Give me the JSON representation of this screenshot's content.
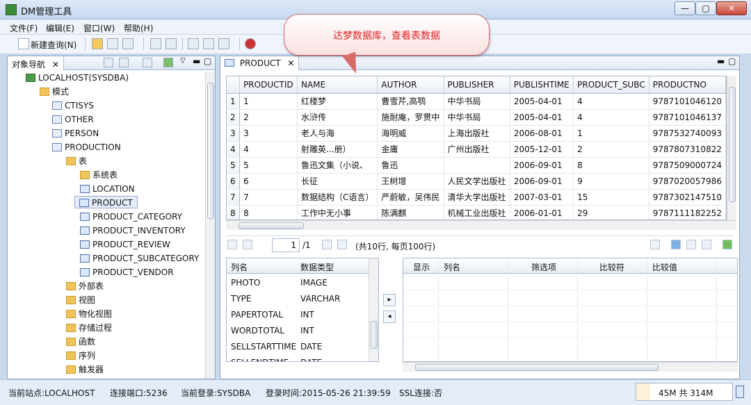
{
  "window": {
    "title": "DM管理工具",
    "controls": [
      "minimize",
      "maximize",
      "close"
    ]
  },
  "menu": [
    "文件(F)",
    "编辑(E)",
    "窗口(W)",
    "帮助(H)"
  ],
  "toolbar": {
    "new_query": "新建查询(N)"
  },
  "callout": "达梦数据库，查看表数据",
  "nav": {
    "tab_label": "对象导航",
    "tree": [
      {
        "label": "LOCALHOST(SYSDBA)",
        "icon": "server-icon"
      },
      {
        "label": "模式",
        "icon": "folder-icon"
      },
      {
        "label": "CTISYS",
        "icon": "schema-icon"
      },
      {
        "label": "OTHER",
        "icon": "schema-icon"
      },
      {
        "label": "PERSON",
        "icon": "schema-icon"
      },
      {
        "label": "PRODUCTION",
        "icon": "schema-icon"
      },
      {
        "label": "表",
        "icon": "folder-icon"
      },
      {
        "label": "系统表",
        "icon": "folder-icon"
      },
      {
        "label": "LOCATION",
        "icon": "table-icon"
      },
      {
        "label": "PRODUCT",
        "icon": "table-icon",
        "selected": true
      },
      {
        "label": "PRODUCT_CATEGORY",
        "icon": "table-icon"
      },
      {
        "label": "PRODUCT_INVENTORY",
        "icon": "table-icon"
      },
      {
        "label": "PRODUCT_REVIEW",
        "icon": "table-icon"
      },
      {
        "label": "PRODUCT_SUBCATEGORY",
        "icon": "table-icon"
      },
      {
        "label": "PRODUCT_VENDOR",
        "icon": "table-icon"
      },
      {
        "label": "外部表",
        "icon": "folder-icon"
      },
      {
        "label": "视图",
        "icon": "folder-icon"
      },
      {
        "label": "物化视图",
        "icon": "folder-icon"
      },
      {
        "label": "存储过程",
        "icon": "folder-icon"
      },
      {
        "label": "函数",
        "icon": "folder-icon"
      },
      {
        "label": "序列",
        "icon": "folder-icon"
      },
      {
        "label": "触发器",
        "icon": "folder-icon"
      }
    ]
  },
  "editor": {
    "tab_label": "PRODUCT",
    "columns": [
      "PRODUCTID",
      "NAME",
      "AUTHOR",
      "PUBLISHER",
      "PUBLISHTIME",
      "PRODUCT_SUBC",
      "PRODUCTNO"
    ],
    "rows": [
      [
        "1",
        "1",
        "红楼梦",
        "曹雪芹,高鹗",
        "中华书局",
        "2005-04-01",
        "4",
        "9787101046120"
      ],
      [
        "2",
        "2",
        "水浒传",
        "施耐庵，罗贯中",
        "中华书局",
        "2005-04-01",
        "4",
        "9787101046137"
      ],
      [
        "3",
        "3",
        "老人与海",
        "海明威",
        "上海出版社",
        "2006-08-01",
        "1",
        "9787532740093"
      ],
      [
        "4",
        "4",
        "射雕英...册）",
        "金庸",
        "广州出版社",
        "2005-12-01",
        "2",
        "9787807310822"
      ],
      [
        "5",
        "5",
        "鲁迅文集（小说、",
        "鲁迅",
        "",
        "2006-09-01",
        "8",
        "9787509000724"
      ],
      [
        "6",
        "6",
        "长征",
        "王树增",
        "人民文学出版社",
        "2006-09-01",
        "9",
        "9787020057986"
      ],
      [
        "7",
        "7",
        "数据结构（C语言）",
        "严蔚敏，吴伟民",
        "清华大学出版社",
        "2007-03-01",
        "15",
        "9787302147510"
      ],
      [
        "8",
        "8",
        "工作中无小事",
        "陈满麒",
        "机械工业出版社",
        "2006-01-01",
        "29",
        "9787111182252"
      ]
    ],
    "pager": {
      "page_input": "1",
      "page_total": "/1",
      "summary": "(共10行, 每页100行)"
    },
    "column_list": {
      "headers": [
        "列名",
        "数据类型"
      ],
      "rows": [
        [
          "PHOTO",
          "IMAGE"
        ],
        [
          "TYPE",
          "VARCHAR"
        ],
        [
          "PAPERTOTAL",
          "INT"
        ],
        [
          "WORDTOTAL",
          "INT"
        ],
        [
          "SELLSTARTTIME",
          "DATE"
        ],
        [
          "SELLENDTIME",
          "DATE"
        ]
      ]
    },
    "filter_headers": [
      "显示",
      "列名",
      "筛选项",
      "比较符",
      "比较值"
    ]
  },
  "status": {
    "site": "当前站点:LOCALHOST",
    "port": "连接端口:5236",
    "login": "当前登录:SYSDBA",
    "login_time": "登录时间:2015-05-26 21:39:59",
    "ssl": "SSL连接:否",
    "memory": "45M 共 314M",
    "memory_used_fraction": 0.143
  }
}
